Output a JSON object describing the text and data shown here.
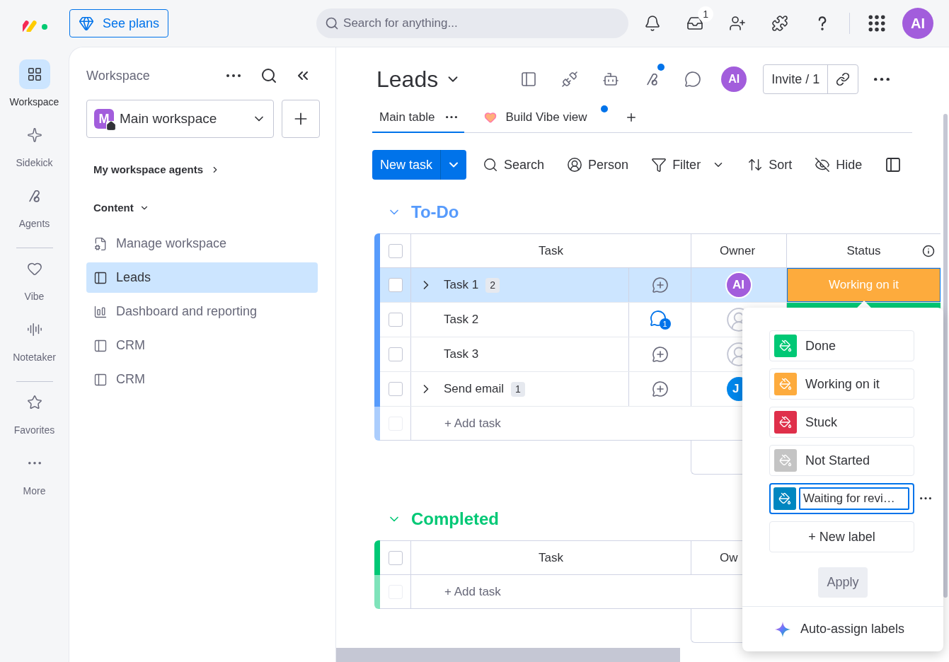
{
  "topbar": {
    "see_plans": "See plans",
    "search": {
      "placeholder": "Search for anything..."
    },
    "inbox_badge": "1",
    "avatar": "AI"
  },
  "rail": {
    "sections": [
      [
        {
          "label": "Workspace",
          "selected": true
        },
        {
          "label": "Sidekick",
          "selected": false
        },
        {
          "label": "Agents",
          "selected": false
        }
      ],
      [
        {
          "label": "Vibe",
          "selected": false
        },
        {
          "label": "Notetaker",
          "selected": false
        }
      ],
      [
        {
          "label": "Favorites",
          "selected": false
        },
        {
          "label": "More",
          "selected": false
        }
      ]
    ]
  },
  "workspace_panel": {
    "title": "Workspace",
    "workspace": {
      "initial": "M",
      "name": "Main workspace"
    },
    "agents_link": "My workspace agents",
    "section": "Content",
    "items": [
      {
        "label": "Manage workspace",
        "kind": "settings",
        "selected": false
      },
      {
        "label": "Leads",
        "kind": "board",
        "selected": true
      },
      {
        "label": "Dashboard and reporting",
        "kind": "dashboard",
        "selected": false
      },
      {
        "label": "CRM",
        "kind": "board",
        "selected": false
      },
      {
        "label": "CRM",
        "kind": "board",
        "selected": false
      }
    ]
  },
  "board": {
    "title": "Leads",
    "agents_unread": true,
    "avatar": "AI",
    "invite": "Invite / 1",
    "tabs": [
      {
        "label": "Main table",
        "kind": "table",
        "selected": true,
        "unread": false
      },
      {
        "label": "Build Vibe view",
        "kind": "vibe",
        "selected": false,
        "unread": true
      }
    ],
    "new_task": "New task",
    "actions": [
      {
        "label": "Search",
        "dropdown": false
      },
      {
        "label": "Person",
        "dropdown": false
      },
      {
        "label": "Filter",
        "dropdown": true
      },
      {
        "label": "Sort",
        "dropdown": false
      },
      {
        "label": "Hide",
        "dropdown": false
      }
    ],
    "groups": [
      {
        "name": "To-Do",
        "color": "#579bfc",
        "all_checked": false,
        "columns": [
          "Task",
          "Owner",
          "Status"
        ],
        "rows": [
          {
            "task": "Task 1",
            "subitems": "2",
            "checked": false,
            "selected": true,
            "comment": {
              "kind": "add"
            },
            "owner": {
              "kind": "initials",
              "text": "AI",
              "color": "#a25ddc"
            },
            "status": {
              "label": "Working on it",
              "color": "#fdab3d"
            }
          },
          {
            "task": "Task 2",
            "checked": false,
            "selected": false,
            "comment": {
              "kind": "count",
              "count": "1"
            },
            "owner": {
              "kind": "empty"
            },
            "status": {
              "color": "#00c875"
            }
          },
          {
            "task": "Task 3",
            "checked": false,
            "selected": false,
            "comment": {
              "kind": "add"
            },
            "owner": {
              "kind": "empty"
            }
          },
          {
            "task": "Send email",
            "subitems": "1",
            "checked": false,
            "selected": false,
            "comment": {
              "kind": "add"
            },
            "owner": {
              "kind": "initials",
              "text": "J",
              "color": "#0086ea"
            }
          }
        ],
        "add_task": "+ Add task"
      },
      {
        "name": "Completed",
        "color": "#00c875",
        "all_checked": false,
        "columns": [
          "Task",
          "Ow"
        ],
        "add_task": "+ Add task"
      }
    ]
  },
  "status_popover": {
    "labels": [
      {
        "label": "Done",
        "color": "#00c875",
        "editing": false
      },
      {
        "label": "Working on it",
        "color": "#fdab3d",
        "editing": false
      },
      {
        "label": "Stuck",
        "color": "#df2f4a",
        "editing": false
      },
      {
        "label": "Not Started",
        "color": "#c4c4c4",
        "editing": false
      },
      {
        "label": "Waiting for revi…",
        "color": "#0086c0",
        "editing": true
      }
    ],
    "new_label": "+ New label",
    "apply": "Apply",
    "auto_assign": "Auto-assign labels"
  }
}
